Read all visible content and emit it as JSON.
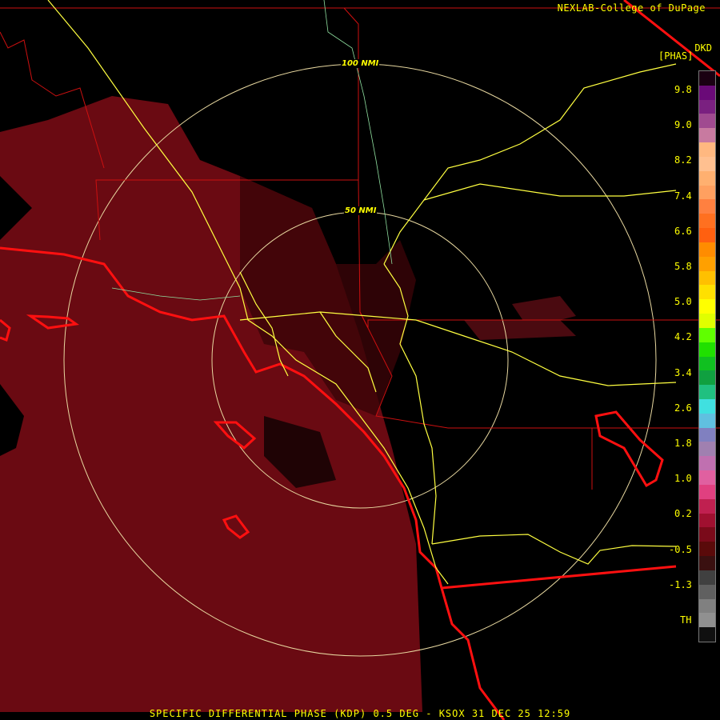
{
  "credit": "NEXLAB-College of DuPage",
  "site": "DKD",
  "units": "[PHAS]",
  "footer": "SPECIFIC DIFFERENTIAL PHASE (KDP) 0.5 DEG - KSOX 31 DEC 25 12:59",
  "range_rings": [
    "50 NMI",
    "100 NMI"
  ],
  "legend": {
    "ticks": [
      "9.8",
      "9.0",
      "8.2",
      "7.4",
      "6.6",
      "5.8",
      "5.0",
      "4.2",
      "3.4",
      "2.6",
      "1.8",
      "1.0",
      "0.2",
      "-0.5",
      "-1.3",
      "TH"
    ],
    "colors": [
      "#1a0012",
      "#6a0a78",
      "#7a2080",
      "#a04a90",
      "#c87aa0",
      "#ffb880",
      "#ffc090",
      "#ffb070",
      "#ffa060",
      "#ff8040",
      "#ff7020",
      "#ff6010",
      "#ff8c00",
      "#ffa000",
      "#ffc000",
      "#ffe000",
      "#ffff00",
      "#e0ff00",
      "#60ff00",
      "#20e000",
      "#10c020",
      "#10a040",
      "#20c080",
      "#40e0e0",
      "#60c0e0",
      "#8080c0",
      "#a080b0",
      "#c070b0",
      "#e060a0",
      "#e04080",
      "#c02050",
      "#a01030",
      "#7a0a1a",
      "#5a0a0a",
      "#3a1010",
      "#404040",
      "#606060",
      "#808080",
      "#909090",
      "#101010"
    ]
  }
}
